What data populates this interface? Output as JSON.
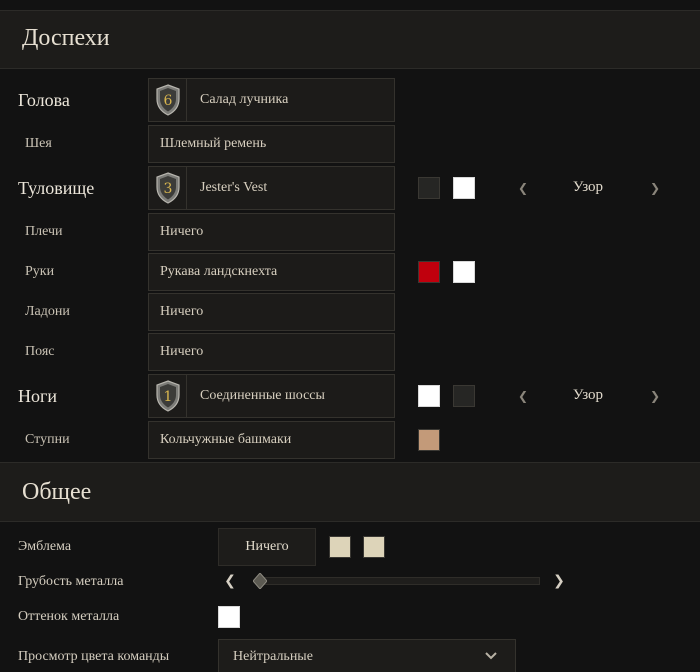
{
  "armor": {
    "title": "Доспехи",
    "rows": [
      {
        "label": "Голова",
        "value": "Салад лучника",
        "badge": "6"
      },
      {
        "label": "Шея",
        "value": "Шлемный ремень"
      },
      {
        "label": "Туловище",
        "value": "Jester's Vest",
        "badge": "3",
        "pattern": "Узор"
      },
      {
        "label": "Плечи",
        "value": "Ничего"
      },
      {
        "label": "Руки",
        "value": "Рукава ландскнехта"
      },
      {
        "label": "Ладони",
        "value": "Ничего"
      },
      {
        "label": "Пояс",
        "value": "Ничего"
      },
      {
        "label": "Ноги",
        "value": "Соединенные шоссы",
        "badge": "1",
        "pattern": "Узор"
      },
      {
        "label": "Ступни",
        "value": "Кольчужные башмаки"
      }
    ]
  },
  "general": {
    "title": "Общее",
    "emblem_label": "Эмблема",
    "emblem_value": "Ничего",
    "roughness_label": "Грубость металла",
    "roughness_level": 0,
    "tint_label": "Оттенок металла",
    "team_label": "Просмотр цвета команды",
    "team_value": "Нейтральные"
  },
  "colors": {
    "dark_swatch": "#262624",
    "white_swatch": "#ffffff",
    "red_swatch": "#c0000d",
    "tan_swatch": "#c39a79",
    "cream_swatch": "#ddd4b9"
  }
}
